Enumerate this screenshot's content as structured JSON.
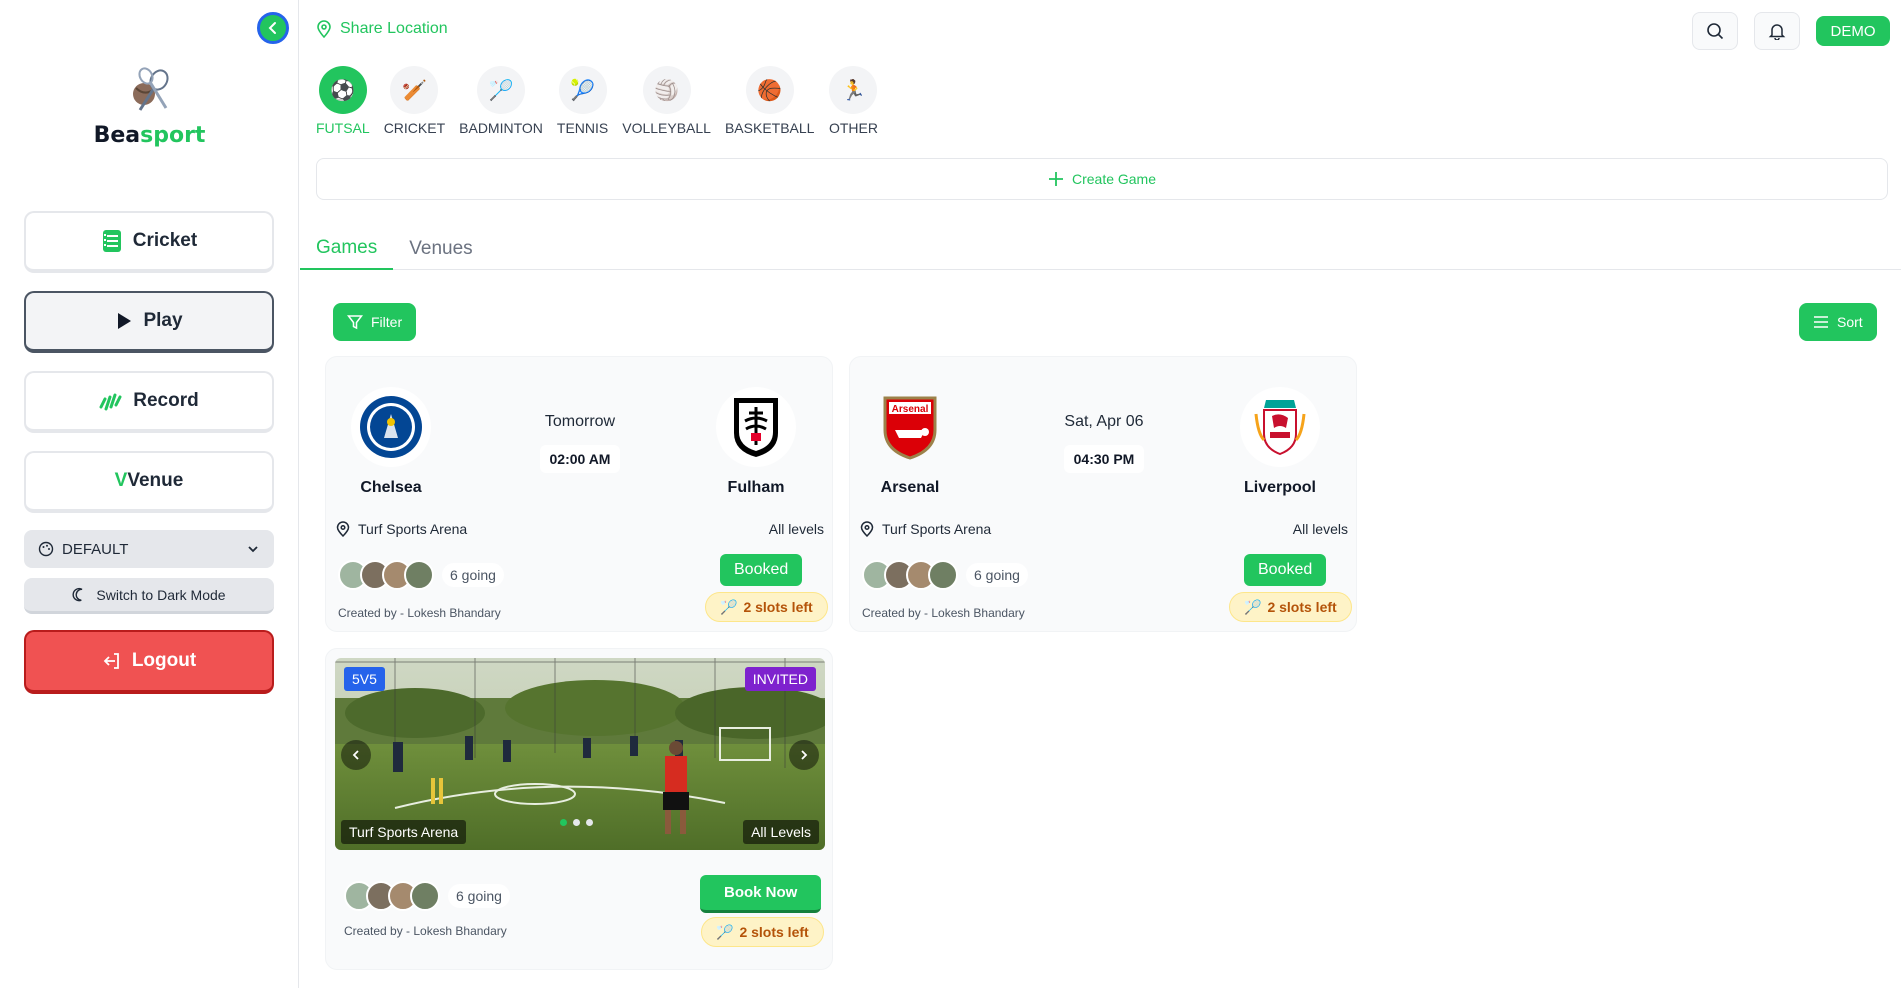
{
  "app": {
    "brand_part1": "Bea",
    "brand_part2": "sport"
  },
  "sidebar": {
    "items": [
      {
        "label": "Cricket",
        "icon": "scorebook-icon"
      },
      {
        "label": "Play",
        "icon": "play-icon"
      },
      {
        "label": "Record",
        "icon": "record-icon"
      },
      {
        "label_prefix": "V",
        "label": "Venue",
        "icon": "venue-icon"
      }
    ],
    "theme_select": "DEFAULT",
    "dark_mode_label": "Switch to Dark Mode",
    "logout_label": "Logout"
  },
  "header": {
    "share_location": "Share Location",
    "demo_badge": "DEMO"
  },
  "sports": [
    {
      "label": "FUTSAL",
      "icon": "⚽",
      "active": true
    },
    {
      "label": "CRICKET",
      "icon": "🏏",
      "active": false
    },
    {
      "label": "BADMINTON",
      "icon": "🏸",
      "active": false
    },
    {
      "label": "TENNIS",
      "icon": "🎾",
      "active": false
    },
    {
      "label": "VOLLEYBALL",
      "icon": "🏐",
      "active": false
    },
    {
      "label": "BASKETBALL",
      "icon": "🏀",
      "active": false
    },
    {
      "label": "OTHER",
      "icon": "🏃",
      "active": false
    }
  ],
  "create_game": "Create Game",
  "tabs": [
    "Games",
    "Venues"
  ],
  "controls": {
    "filter": "Filter",
    "sort": "Sort"
  },
  "games": [
    {
      "home": "Chelsea",
      "away": "Fulham",
      "date": "Tomorrow",
      "time": "02:00 AM",
      "venue": "Turf Sports Arena",
      "levels": "All levels",
      "going": "6 going",
      "created_by": "Created by - Lokesh Bhandary",
      "status": "Booked",
      "slots": "2 slots left",
      "colors": {
        "home": "#034694",
        "away": "#000000"
      }
    },
    {
      "home": "Arsenal",
      "away": "Liverpool",
      "date": "Sat, Apr 06",
      "time": "04:30 PM",
      "venue": "Turf Sports Arena",
      "levels": "All levels",
      "going": "6 going",
      "created_by": "Created by - Lokesh Bhandary",
      "status": "Booked",
      "slots": "2 slots left",
      "colors": {
        "home": "#db0007",
        "away": "#c8102e"
      }
    }
  ],
  "venue_card": {
    "format_tag": "5V5",
    "invite_tag": "INVITED",
    "venue": "Turf Sports Arena",
    "levels": "All Levels",
    "going": "6 going",
    "created_by": "Created by - Lokesh Bhandary",
    "cta": "Book Now",
    "slots": "2 slots left",
    "slide_count": 3,
    "active_slide": 1
  },
  "colors": {
    "accent": "#22c55e",
    "danger": "#f05252",
    "tag_blue": "#2563eb",
    "tag_purple": "#7e22ce"
  }
}
